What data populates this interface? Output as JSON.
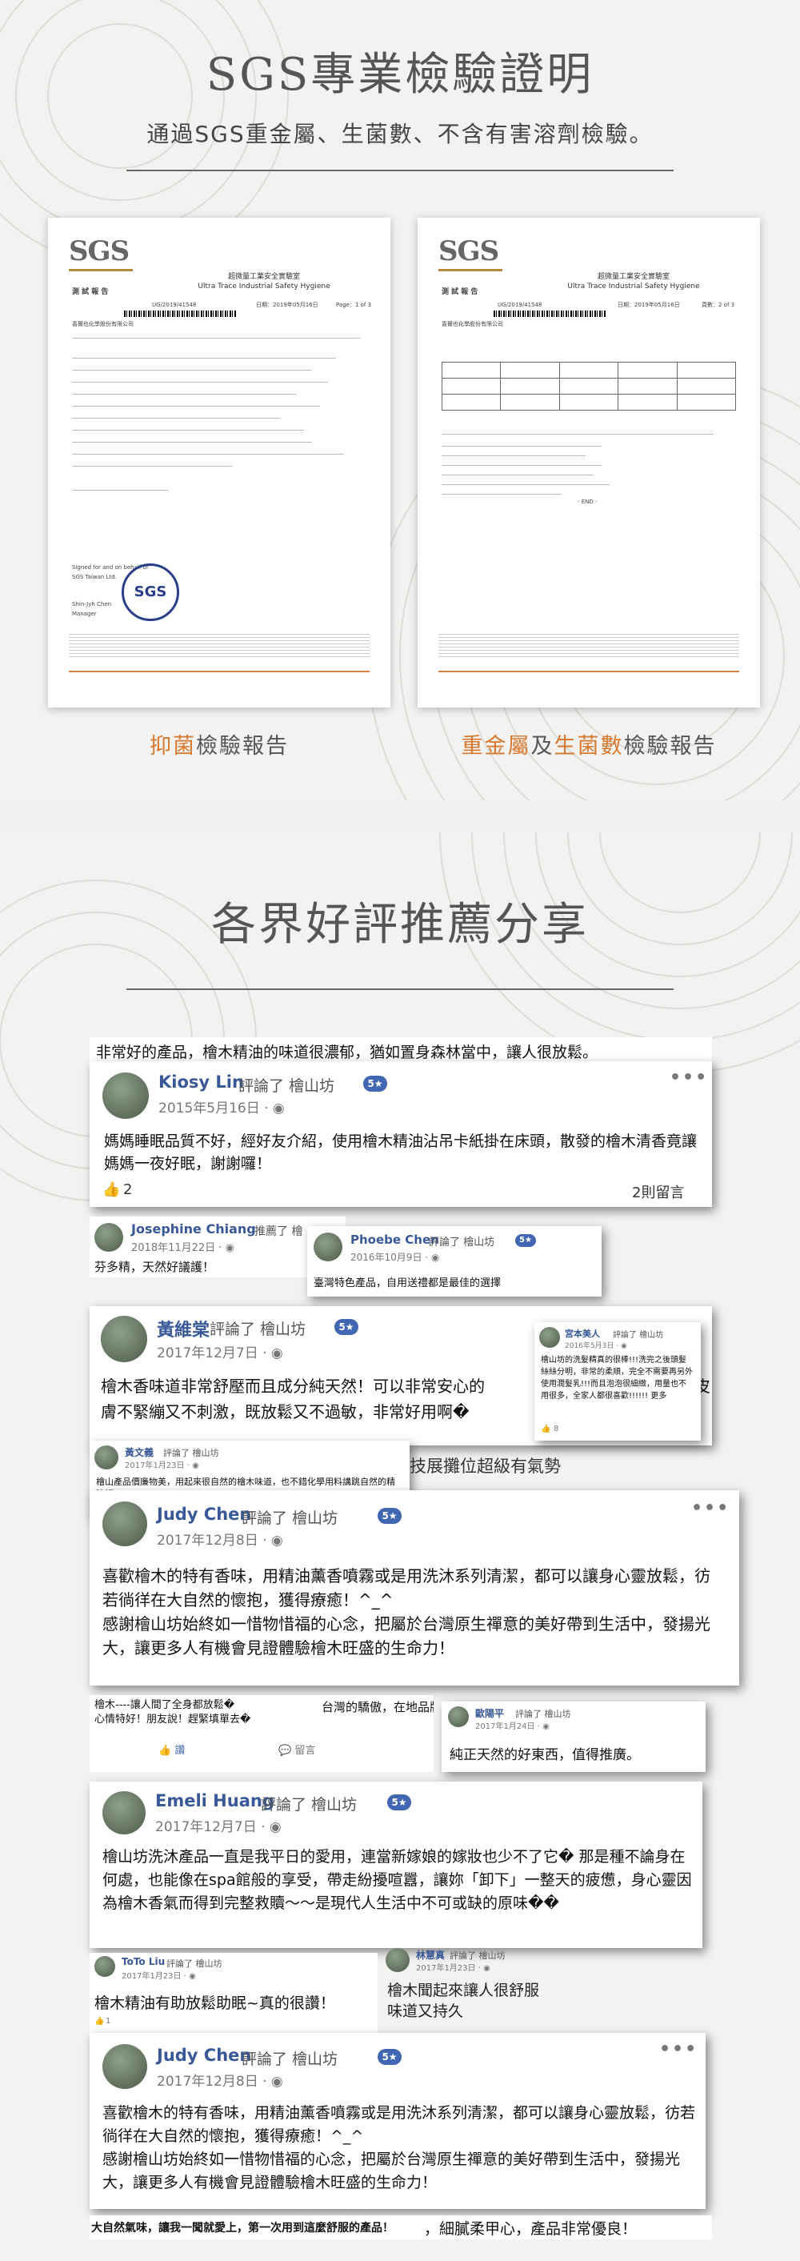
{
  "section1": {
    "title": "SGS專業檢驗證明",
    "subtitle": "通過SGS重金屬、生菌數、不含有害溶劑檢驗。",
    "docs": [
      {
        "logo": "SGS",
        "lab_cn": "超微量工業安全實驗室",
        "lab_en": "Ultra Trace Industrial Safety Hygiene",
        "doc_title": "測 試 報 告",
        "report_no": "UG/2019/41548",
        "page": "Page：1 of 3",
        "date": "日期：2019年05月16日",
        "client": "喜爾也化學股份有限公司",
        "signed": "Signed for and on behalf of",
        "company": "SGS Taiwan Ltd.",
        "signer": "Shin-Jyh Chen",
        "role": "Manager",
        "seal": "SGS"
      },
      {
        "logo": "SGS",
        "lab_cn": "超微量工業安全實驗室",
        "lab_en": "Ultra Trace Industrial Safety Hygiene",
        "doc_title": "測 試 報 告",
        "report_no": "UG/2019/41548",
        "page": "頁數：2 of 3",
        "date": "日期：2019年05月16日",
        "client": "喜爾也化學股份有限公司",
        "end": "- END -"
      }
    ],
    "caption_left": {
      "o": "抑菌",
      "t": "檢驗報告"
    },
    "caption_right": {
      "o1": "重金屬",
      "t1": "及",
      "o2": "生菌數",
      "t2": "檢驗報告"
    }
  },
  "section2": {
    "title": "各界好評推薦分享",
    "top_strip": "非常好的產品，檜木精油的味道很濃郁，猶如置身森林當中，讓人很放鬆。",
    "reviews": [
      {
        "name": "Kiosy Lin",
        "action": "評論了 檜山坊",
        "stars": "5★",
        "date": "2015年5月16日 · ◉",
        "body": "媽媽睡眠品質不好，經好友介紹，使用檜木精油沾吊卡紙掛在床頭，散發的檜木清香竟讓媽媽一夜好眠，謝謝囉！",
        "likes": "2",
        "comments": "2則留言"
      },
      {
        "name": "Josephine Chiang",
        "action": "推薦了 檜",
        "date": "2018年11月22日 · ◉",
        "body": "芬多精，天然好議護！"
      },
      {
        "name": "Phoebe Chen",
        "action": "評論了 檜山坊",
        "stars": "5★",
        "date": "2016年10月9日 · ◉",
        "body": "臺灣特色產品，自用送禮都是最佳的選擇"
      },
      {
        "name": "黃維棠",
        "action": "評論了 檜山坊",
        "stars": "5★",
        "date": "2017年12月7日 · ◉",
        "body": "檜木香味道非常舒壓而且成分純天然！可以非常安心的",
        "body2": "膚不緊繃又不刺激，既放鬆又不過敏，非常好用啊�",
        "tail": "皮"
      },
      {
        "name": "宮本美人",
        "action": "評論了 檜山坊",
        "date": "2016年5月3日 · ◉",
        "body": "檜山坊的洗髮精真的很棒!!!洗完之後頭髮絲絲分明，非常的柔順，完全不需要再另外使用潤髮乳!!!而且泡泡很細緻，用量也不用很多，全家人都很喜歡!!!!!! 更多",
        "likes": "8"
      },
      {
        "name": "黃文義",
        "action": "評論了 檜山坊",
        "date": "2017年1月23日 · ◉",
        "body": "檜山產品價廉物美，用起來很自然的檜木味道，也不錯化學用料講跳自然的精油好"
      },
      {
        "frag": "技展攤位超級有氣勢"
      },
      {
        "name": "Judy Chen",
        "action": "評論了 檜山坊",
        "stars": "5★",
        "date": "2017年12月8日 · ◉",
        "body": "喜歡檜木的特有香味，用精油薰香噴霧或是用洗沐系列清潔，都可以讓身心靈放鬆，彷若徜徉在大自然的懷抱，獲得療癒！^_^\n感謝檜山坊始終如一惜物惜福的心念，把屬於台灣原生禪意的美好帶到生活中，發揚光大，讓更多人有機會見證體驗檜木旺盛的生命力！"
      },
      {
        "frag": "檜木----讓人間了全身都放鬆�\n心情特好！朋友說！趕緊填單去�",
        "frag2": "台灣的驕傲，在地品牌發光！",
        "like_lbl": "讚",
        "comment_lbl": "留言"
      },
      {
        "name": "歐陽平",
        "action": "評論了 檜山坊",
        "date": "2017年1月24日 · ◉",
        "body": "純正天然的好東西，值得推廣。"
      },
      {
        "name": "Emeli Huang",
        "action": "評論了 檜山坊",
        "stars": "5★",
        "date": "2017年12月7日 · ◉",
        "body": "檜山坊洗沐產品一直是我平日的愛用，連當新嫁娘的嫁妝也少不了它� 那是種不論身在何處，也能像在spa館般的享受，帶走紛擾喧囂，讓妳「卸下」一整天的疲憊，身心靈因為檜木香氣而得到完整救贖～～是現代人生活中不可或缺的原味��"
      },
      {
        "name": "ToTo Liu",
        "action": "評論了 檜山坊",
        "date": "2017年1月23日 · ◉",
        "body": "檜木精油有助放鬆助眠~真的很讚！",
        "likes": "1"
      },
      {
        "name": "林慧真",
        "action": "評論了 檜山坊",
        "date": "2017年1月23日 · ◉",
        "body": "檜木聞起來讓人很舒服\n味道又持久"
      },
      {
        "name": "Judy Chen",
        "action": "評論了 檜山坊",
        "stars": "5★",
        "date": "2017年12月8日 · ◉",
        "body": "喜歡檜木的特有香味，用精油薰香噴霧或是用洗沐系列清潔，都可以讓身心靈放鬆，彷若徜徉在大自然的懷抱，獲得療癒！^_^\n感謝檜山坊始終如一惜物惜福的心念，把屬於台灣原生禪意的美好帶到生活中，發揚光大，讓更多人有機會見證體驗檜木旺盛的生命力！"
      }
    ],
    "bottom_strip_left": "大自然氣味，讓我一聞就愛上，第一次用到這麼舒服的產品！",
    "bottom_strip_right": "，細膩柔甲心，產品非常優良！"
  }
}
